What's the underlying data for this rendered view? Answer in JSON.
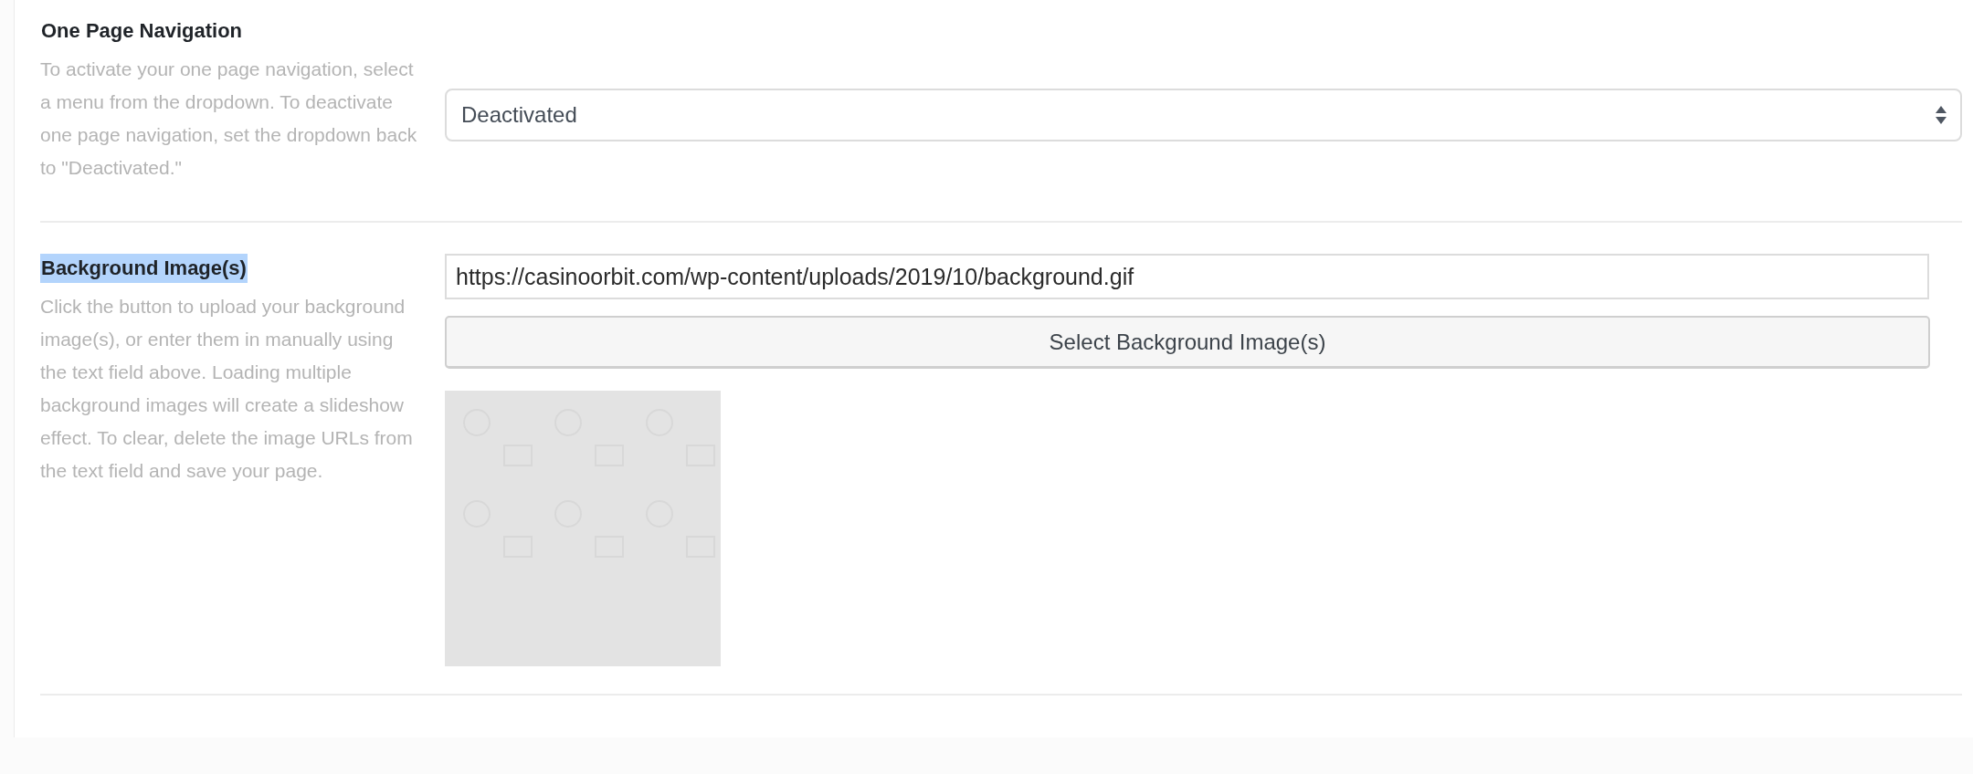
{
  "sections": [
    {
      "title": "One Page Navigation",
      "title_highlighted": false,
      "description": "To activate your one page navigation, select a menu from the dropdown. To deactivate one page navigation, set the dropdown back to \"Deactivated.\"",
      "controls": [
        {
          "kind": "select",
          "value": "Deactivated"
        }
      ]
    },
    {
      "title": "Background Image(s)",
      "title_highlighted": true,
      "description": "Click the button to upload your background image(s), or enter them in manually using the text field above. Loading multiple background images will create a slideshow effect. To clear, delete the image URLs from the text field and save your page.",
      "controls": [
        {
          "kind": "input",
          "value": "https://casinoorbit.com/wp-content/uploads/2019/10/background.gif"
        },
        {
          "kind": "button",
          "label": "Select Background Image(s)"
        },
        {
          "kind": "preview"
        }
      ]
    }
  ]
}
